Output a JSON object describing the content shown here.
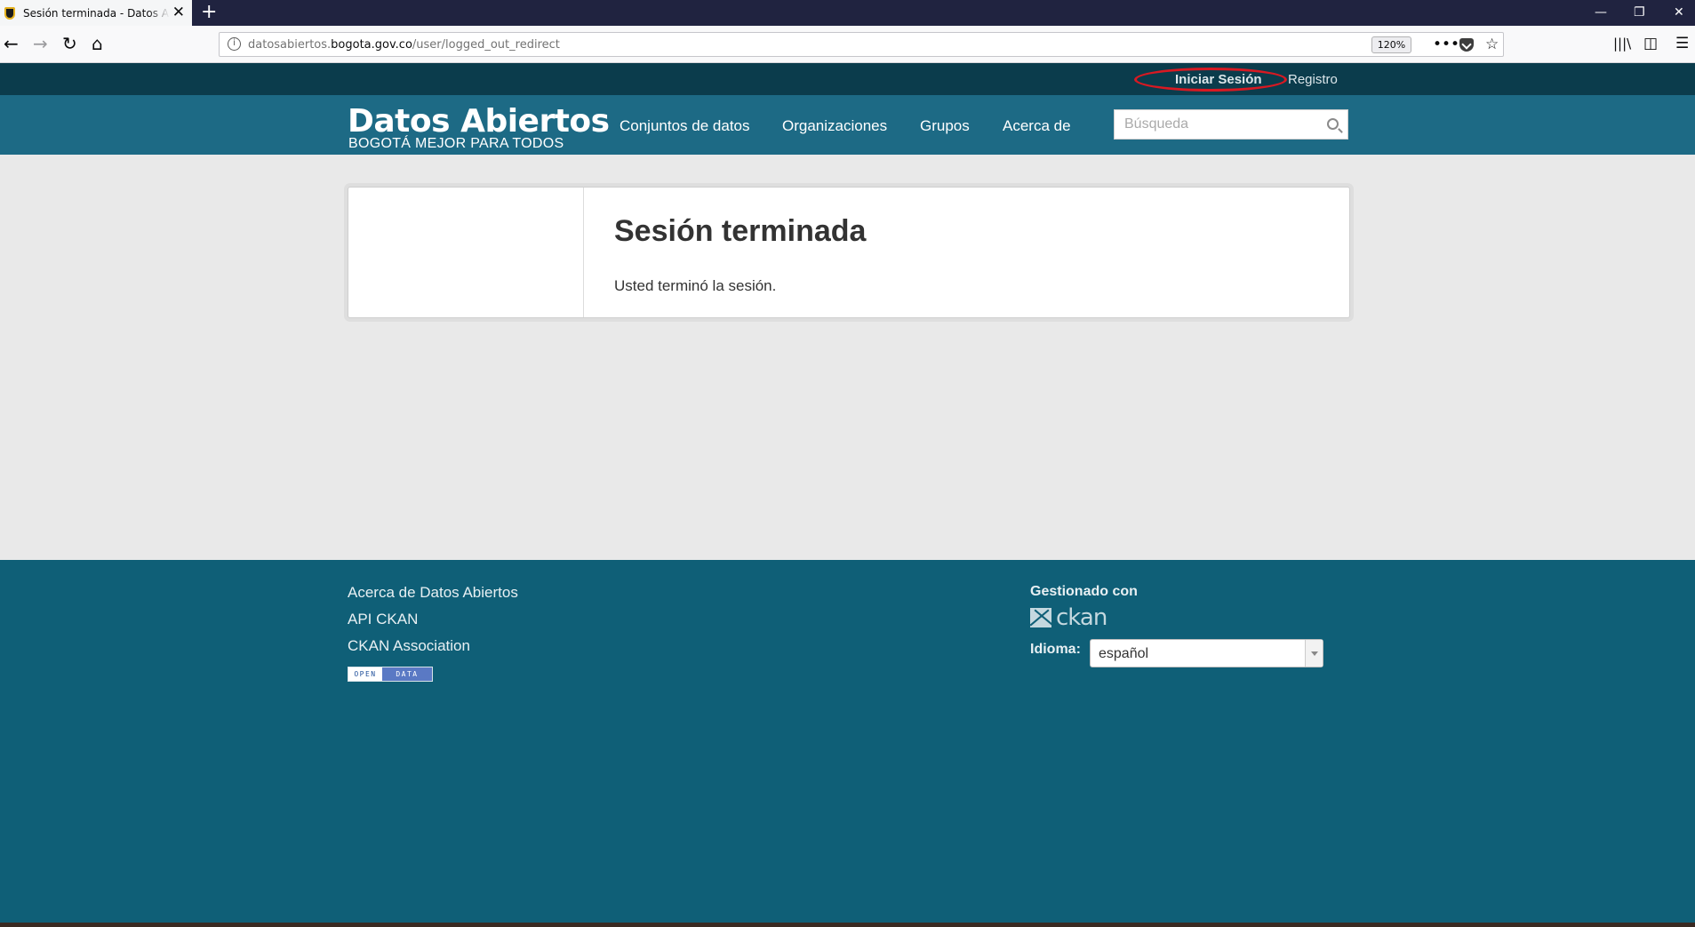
{
  "browser": {
    "tab_title": "Sesión terminada - Datos Abiertos",
    "url_prefix": "datosabiertos.",
    "url_domain": "bogota.gov.co",
    "url_path": "/user/logged_out_redirect",
    "zoom": "120%"
  },
  "account": {
    "login": "Iniciar Sesión",
    "register": "Registro"
  },
  "header": {
    "logo_title": "Datos Abiertos",
    "logo_subtitle": "BOGOTÁ MEJOR PARA TODOS",
    "nav": [
      "Conjuntos de datos",
      "Organizaciones",
      "Grupos",
      "Acerca de"
    ],
    "search_placeholder": "Búsqueda"
  },
  "main": {
    "title": "Sesión terminada",
    "message": "Usted terminó la sesión."
  },
  "footer": {
    "links": [
      "Acerca de Datos Abiertos",
      "API CKAN",
      "CKAN Association"
    ],
    "badge_left": "OPEN",
    "badge_right": "DATA",
    "powered_by": "Gestionado con",
    "ckan_logo": "ckan",
    "language_label": "Idioma:",
    "language_value": "español"
  }
}
